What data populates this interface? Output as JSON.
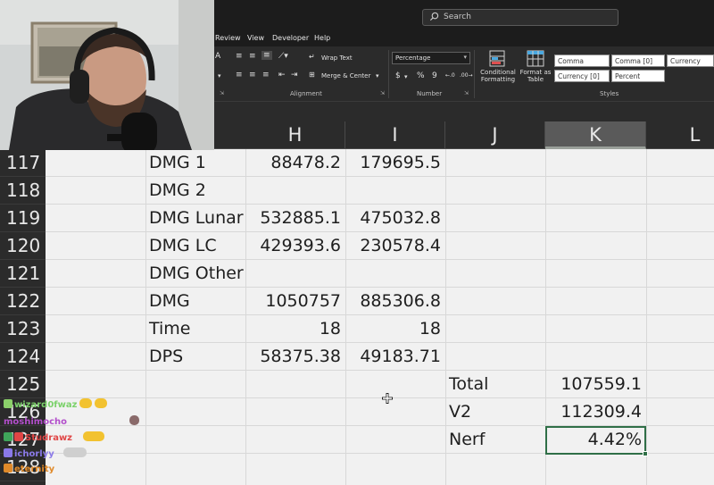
{
  "search": {
    "placeholder": "Search",
    "icon": "search-icon"
  },
  "menu_tabs": [
    "Review",
    "View",
    "Developer",
    "Help"
  ],
  "ribbon": {
    "wrap_text": "Wrap Text",
    "merge_center": "Merge & Center",
    "number_format": "Percentage",
    "number_symbols": {
      "currency": "$",
      "percent": "%",
      "comma": "9"
    },
    "conditional_formatting": "Conditional\nFormatting",
    "format_as_table": "Format as\nTable",
    "groups": {
      "alignment": "Alignment",
      "number": "Number",
      "styles": "Styles"
    },
    "cell_styles": [
      "Comma",
      "Comma [0]",
      "Currency",
      "Currency [0]",
      "Percent"
    ]
  },
  "columns": [
    "H",
    "I",
    "J",
    "K",
    "L"
  ],
  "selected_column": "K",
  "rows": [
    {
      "num": "117",
      "g": "DMG 1",
      "h": "88478.2",
      "i": "179695.5",
      "j": "",
      "k": ""
    },
    {
      "num": "118",
      "g": "DMG 2",
      "h": "",
      "i": "",
      "j": "",
      "k": ""
    },
    {
      "num": "119",
      "g": "DMG Lunar",
      "h": "532885.1",
      "i": "475032.8",
      "j": "",
      "k": ""
    },
    {
      "num": "120",
      "g": "DMG LC",
      "h": "429393.6",
      "i": "230578.4",
      "j": "",
      "k": ""
    },
    {
      "num": "121",
      "g": "DMG Other",
      "h": "",
      "i": "",
      "j": "",
      "k": ""
    },
    {
      "num": "122",
      "g": "DMG",
      "h": "1050757",
      "i": "885306.8",
      "j": "",
      "k": ""
    },
    {
      "num": "123",
      "g": "Time",
      "h": "18",
      "i": "18",
      "j": "",
      "k": ""
    },
    {
      "num": "124",
      "g": "DPS",
      "h": "58375.38",
      "i": "49183.71",
      "j": "",
      "k": ""
    },
    {
      "num": "125",
      "g": "",
      "h": "",
      "i": "",
      "j": "Total",
      "k": "107559.1"
    },
    {
      "num": "126",
      "g": "",
      "h": "",
      "i": "",
      "j": "V2",
      "k": "112309.4"
    },
    {
      "num": "127",
      "g": "",
      "h": "",
      "i": "",
      "j": "Nerf",
      "k": "4.42%"
    },
    {
      "num": "128",
      "g": "",
      "h": "",
      "i": "",
      "j": "",
      "k": ""
    }
  ],
  "chat": [
    {
      "user": "wizard0fwaz",
      "color": "#7bd16a"
    },
    {
      "user": "moshimocho",
      "color": "#b24ecb"
    },
    {
      "user": "Studrawz",
      "color": "#e04545"
    },
    {
      "user": "ichorlyy",
      "color": "#8a79e8"
    },
    {
      "user": "eternity",
      "color": "#e08a2a"
    }
  ]
}
